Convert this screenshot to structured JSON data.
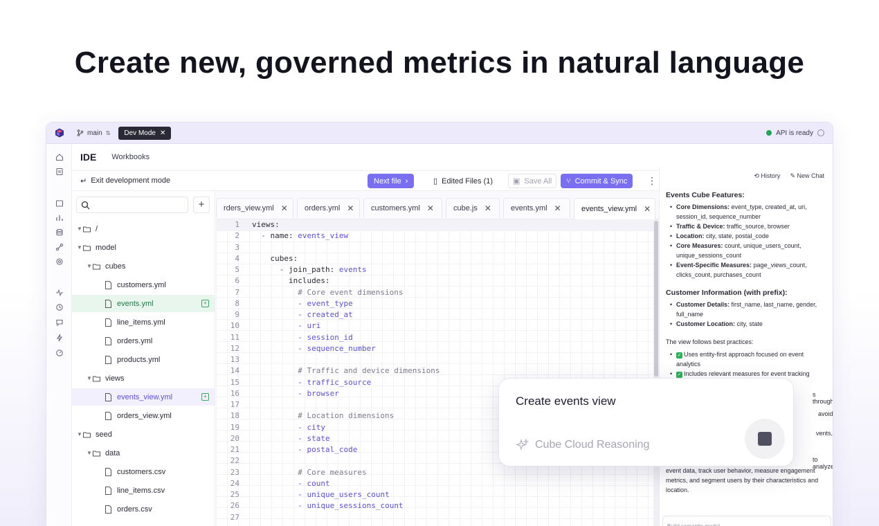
{
  "headline": "Create new, governed metrics in natural language",
  "topbar": {
    "branch": "main",
    "dev_mode": "Dev Mode",
    "api_status": "API is ready",
    "status_color": "#22a559"
  },
  "nav": {
    "ide": "IDE",
    "workbooks": "Workbooks"
  },
  "toolbar": {
    "exit": "Exit development mode",
    "next_file": "Next file",
    "edited_files": "Edited Files (1)",
    "save_all": "Save All",
    "commit_sync": "Commit & Sync",
    "accent": "#7a6ff0"
  },
  "tree": {
    "search_placeholder": "",
    "items": [
      {
        "label": "/",
        "type": "folder"
      },
      {
        "label": "model",
        "type": "folder"
      },
      {
        "label": "cubes",
        "type": "folder"
      },
      {
        "label": "customers.yml",
        "type": "file"
      },
      {
        "label": "events.yml",
        "type": "file"
      },
      {
        "label": "line_items.yml",
        "type": "file"
      },
      {
        "label": "orders.yml",
        "type": "file"
      },
      {
        "label": "products.yml",
        "type": "file"
      },
      {
        "label": "views",
        "type": "folder"
      },
      {
        "label": "events_view.yml",
        "type": "file"
      },
      {
        "label": "orders_view.yml",
        "type": "file"
      },
      {
        "label": "seed",
        "type": "folder"
      },
      {
        "label": "data",
        "type": "folder"
      },
      {
        "label": "customers.csv",
        "type": "file"
      },
      {
        "label": "line_items.csv",
        "type": "file"
      },
      {
        "label": "orders.csv",
        "type": "file"
      }
    ]
  },
  "tabs": [
    {
      "label": "rders_view.yml"
    },
    {
      "label": "orders.yml"
    },
    {
      "label": "customers.yml"
    },
    {
      "label": "cube.js"
    },
    {
      "label": "events.yml"
    },
    {
      "label": "events_view.yml"
    }
  ],
  "code": [
    {
      "n": "1",
      "k": "views:",
      "v": ""
    },
    {
      "n": "2",
      "k": "  - name: ",
      "v": "events_view"
    },
    {
      "n": "3",
      "k": "",
      "v": ""
    },
    {
      "n": "4",
      "k": "    cubes:",
      "v": ""
    },
    {
      "n": "5",
      "k": "      - join_path: ",
      "v": "events"
    },
    {
      "n": "6",
      "k": "        includes:",
      "v": ""
    },
    {
      "n": "7",
      "c": "          # Core event dimensions"
    },
    {
      "n": "8",
      "d": "          - event_type"
    },
    {
      "n": "9",
      "d": "          - created_at"
    },
    {
      "n": "10",
      "d": "          - uri"
    },
    {
      "n": "11",
      "d": "          - session_id"
    },
    {
      "n": "12",
      "d": "          - sequence_number"
    },
    {
      "n": "13",
      "k": "",
      "v": ""
    },
    {
      "n": "14",
      "c": "          # Traffic and device dimensions"
    },
    {
      "n": "15",
      "d": "          - traffic_source"
    },
    {
      "n": "16",
      "d": "          - browser"
    },
    {
      "n": "17",
      "k": "",
      "v": ""
    },
    {
      "n": "18",
      "c": "          # Location dimensions"
    },
    {
      "n": "19",
      "d": "          - city"
    },
    {
      "n": "20",
      "d": "          - state"
    },
    {
      "n": "21",
      "d": "          - postal_code"
    },
    {
      "n": "22",
      "k": "",
      "v": ""
    },
    {
      "n": "23",
      "c": "          # Core measures"
    },
    {
      "n": "24",
      "d": "          - count"
    },
    {
      "n": "25",
      "d": "          - unique_users_count"
    },
    {
      "n": "26",
      "d": "          - unique_sessions_count"
    },
    {
      "n": "27",
      "k": "",
      "v": ""
    }
  ],
  "chat": {
    "history": "History",
    "new_chat": "New Chat",
    "section1_title": "Events Cube Features:",
    "section1": [
      {
        "b": "Core Dimensions:",
        "t": " event_type, created_at, uri, session_id, sequence_number"
      },
      {
        "b": "Traffic & Device:",
        "t": " traffic_source, browser"
      },
      {
        "b": "Location:",
        "t": " city, state, postal_code"
      },
      {
        "b": "Core Measures:",
        "t": " count, unique_users_count, unique_sessions_count"
      },
      {
        "b": "Event-Specific Measures:",
        "t": " page_views_count, clicks_count, purchases_count"
      }
    ],
    "section2_title": "Customer Information (with prefix):",
    "section2": [
      {
        "b": "Customer Details:",
        "t": " first_name, last_name, gender, full_name"
      },
      {
        "b": "Customer Location:",
        "t": " city, state"
      }
    ],
    "practices_intro": "The view follows best practices:",
    "practices": [
      "Uses entity-first approach focused on event analytics",
      "Includes relevant measures for event tracking"
    ],
    "partial1": "s through",
    "partial2": "avoid",
    "partial3": "vents,",
    "partial4": "to analyze",
    "tail": "event data, track user behavior, measure engagement metrics, and segment users by their characteristics and location.",
    "input_text": "Build semantic model"
  },
  "prompt": {
    "text": "Create events view",
    "status": "Cube Cloud Reasoning"
  }
}
